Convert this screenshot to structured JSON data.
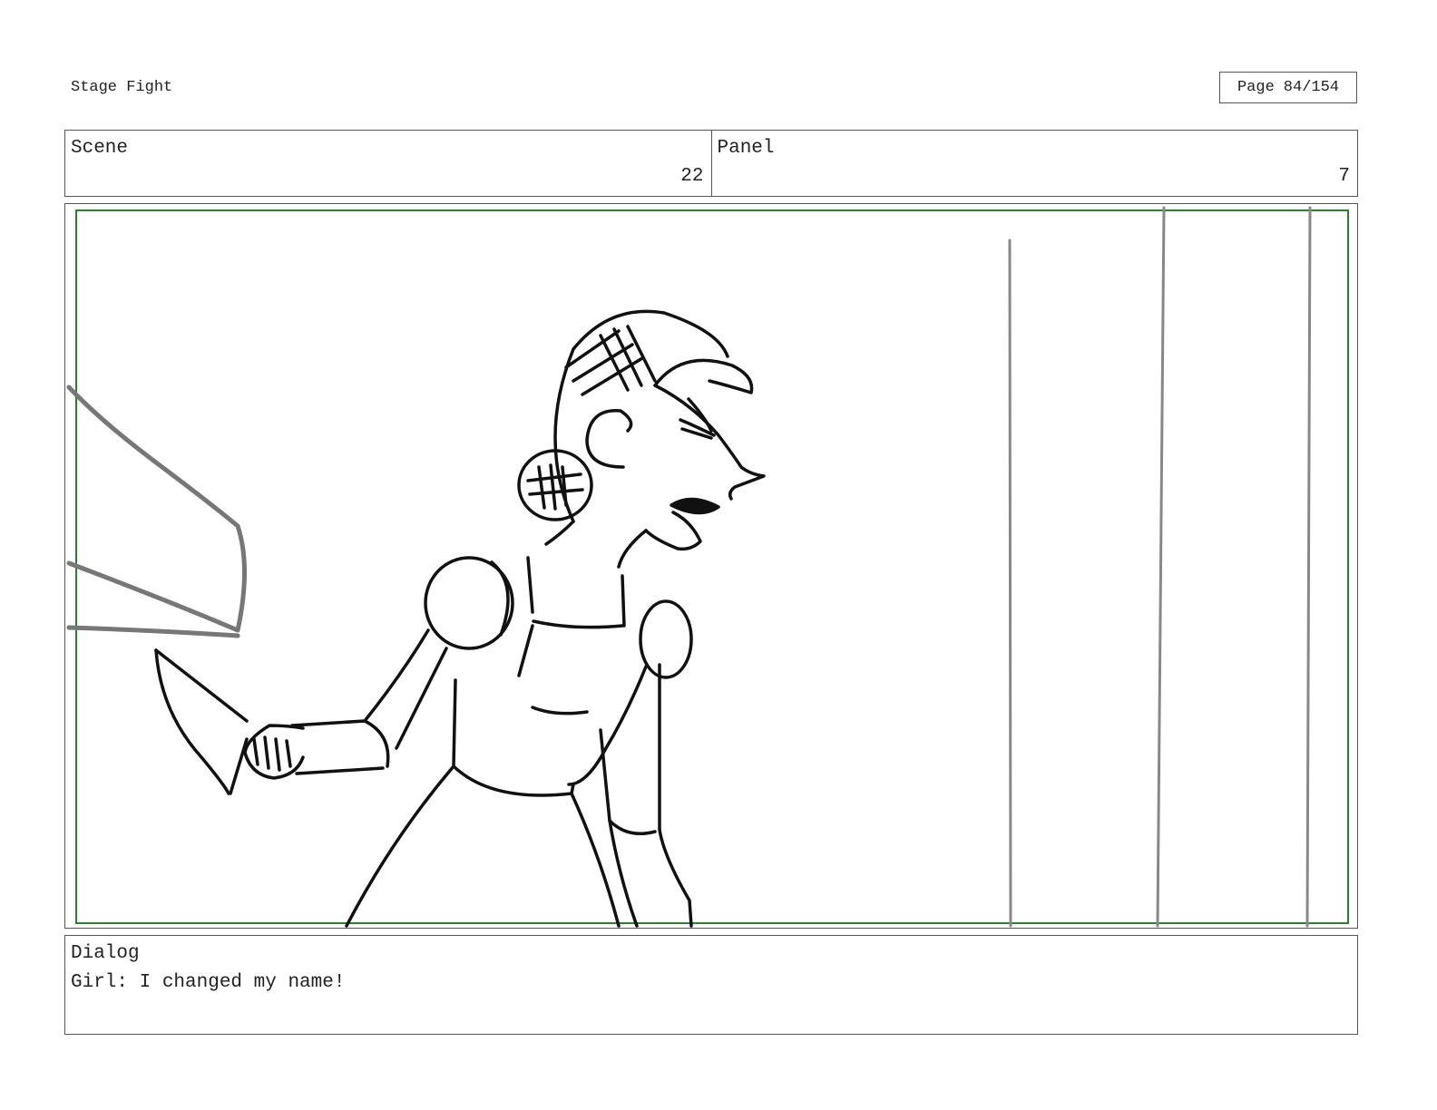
{
  "header": {
    "title": "Stage Fight",
    "page_label": "Page",
    "page_number": "84/154"
  },
  "info": {
    "scene_label": "Scene",
    "scene_value": "22",
    "panel_label": "Panel",
    "panel_value": "7"
  },
  "dialog": {
    "label": "Dialog",
    "text": "Girl: I changed my name!"
  },
  "colors": {
    "safe_frame": "#2e7d32",
    "sketch": "#111111",
    "background_sketch": "#888888"
  }
}
